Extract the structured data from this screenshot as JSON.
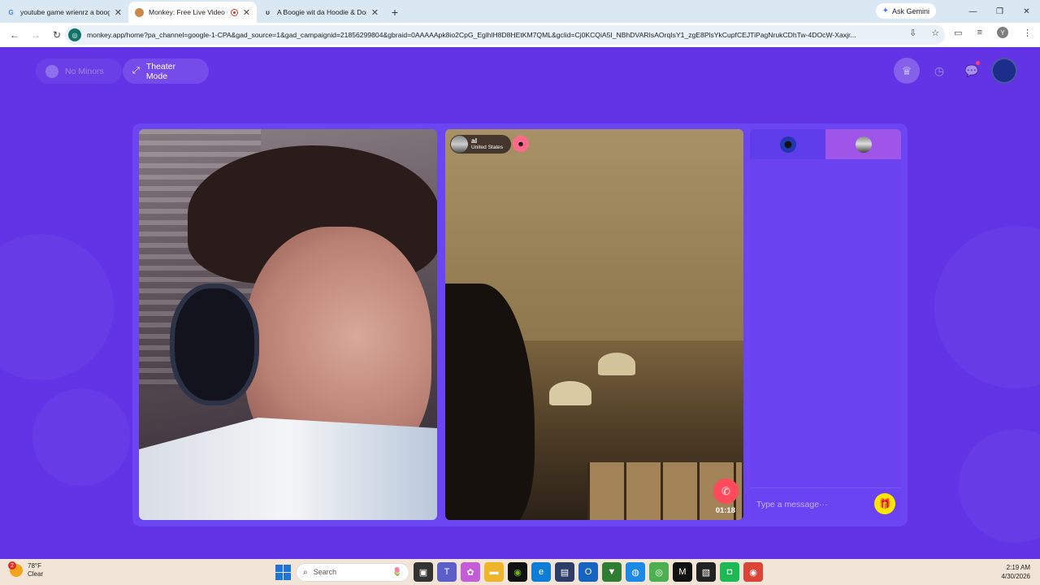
{
  "browser": {
    "tabs": [
      {
        "title": "youtube game wrienrz a boogie",
        "favicon": "G",
        "active": false
      },
      {
        "title": "Monkey: Free Live Video Ch",
        "favicon": "🐵",
        "active": true
      },
      {
        "title": "A Boogie wit da Hoodie & Don",
        "favicon": "Y",
        "active": false
      }
    ],
    "ask_gemini": "Ask Gemini",
    "url": "monkey.app/home?pa_channel=google-1-CPA&gad_source=1&gad_campaignid=21856299804&gbraid=0AAAAApk8io2CpG_EglhlH8D8HEtKM7QML&gclid=Cj0KCQiA5I_NBhDVARIsAOrqIsY1_zgE8PlsYkCupfCEJTiPagNrukCDhTw-4DOcW-Xaxjr..."
  },
  "page": {
    "no_minors_label": "No Minors",
    "theater_mode_label": "Theater Mode",
    "remote_user": {
      "name": "al",
      "country": "United States"
    },
    "call_timer": "01:18",
    "chat_placeholder": "Type a message···"
  },
  "taskbar": {
    "weather_temp": "78°F",
    "weather_desc": "Clear",
    "weather_badge": "2",
    "search_label": "Search",
    "time": "2:19 AM",
    "date": "4/30/2026"
  },
  "colors": {
    "page_bg": "#6234e6",
    "accent_pink": "#ff4a5c",
    "gift_yellow": "#ffe600",
    "active_chat_tab": "#a055e9"
  }
}
